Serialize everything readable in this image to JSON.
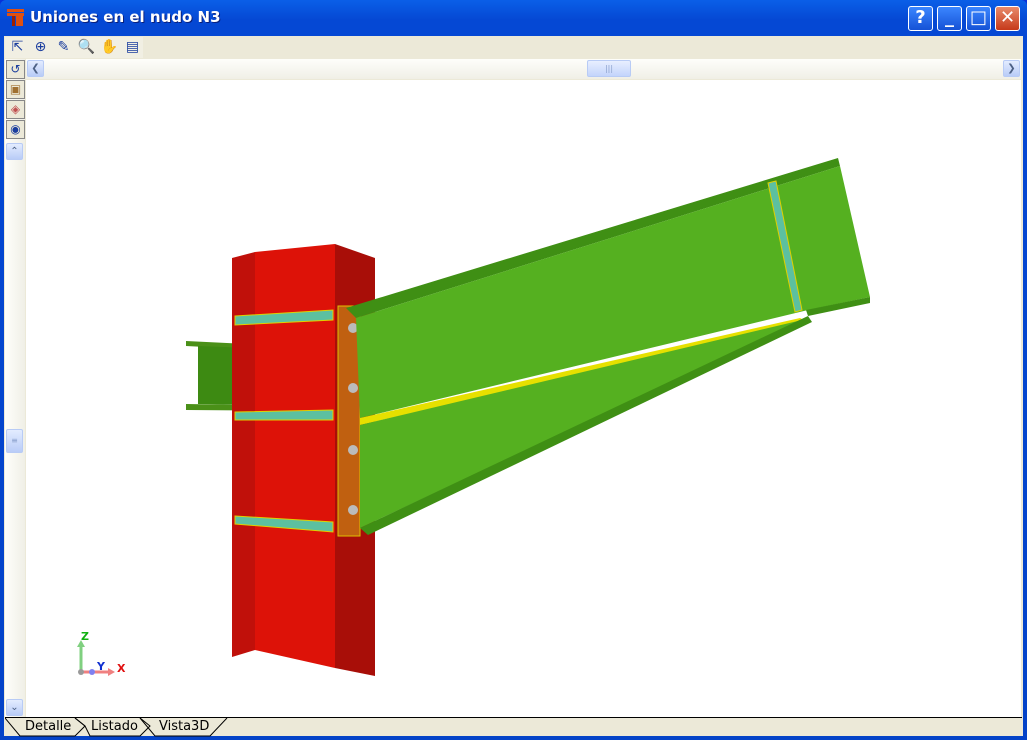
{
  "window": {
    "title": "Uniones en el nudo N3",
    "buttons": [
      "?",
      "_",
      "□",
      "✕"
    ]
  },
  "toolbar": [
    {
      "icon": "select-icon",
      "glyph": "⇱"
    },
    {
      "icon": "zoom-all-icon",
      "glyph": "⊕"
    },
    {
      "icon": "pencil-icon",
      "glyph": "✎"
    },
    {
      "icon": "zoom-window-icon",
      "glyph": "🔍"
    },
    {
      "icon": "pan-hand-icon",
      "glyph": "✋"
    },
    {
      "icon": "export-icon",
      "glyph": "▤"
    }
  ],
  "side_tools": [
    {
      "icon": "rotate-icon",
      "glyph": "↺"
    },
    {
      "icon": "cube-icon",
      "glyph": "▣"
    },
    {
      "icon": "cube-rotate-icon",
      "glyph": "◈"
    },
    {
      "icon": "eye-icon",
      "glyph": "◉"
    }
  ],
  "axes": {
    "z": "Z",
    "y": "Y",
    "x": "X"
  },
  "tabs": [
    "Detalle",
    "Listado",
    "Vista3D"
  ],
  "active_tab": "Vista3D",
  "colors": {
    "column": "#dd1208",
    "beam": "#55b020",
    "stiffener": "#5cc0a0",
    "plate": "#c06010"
  }
}
